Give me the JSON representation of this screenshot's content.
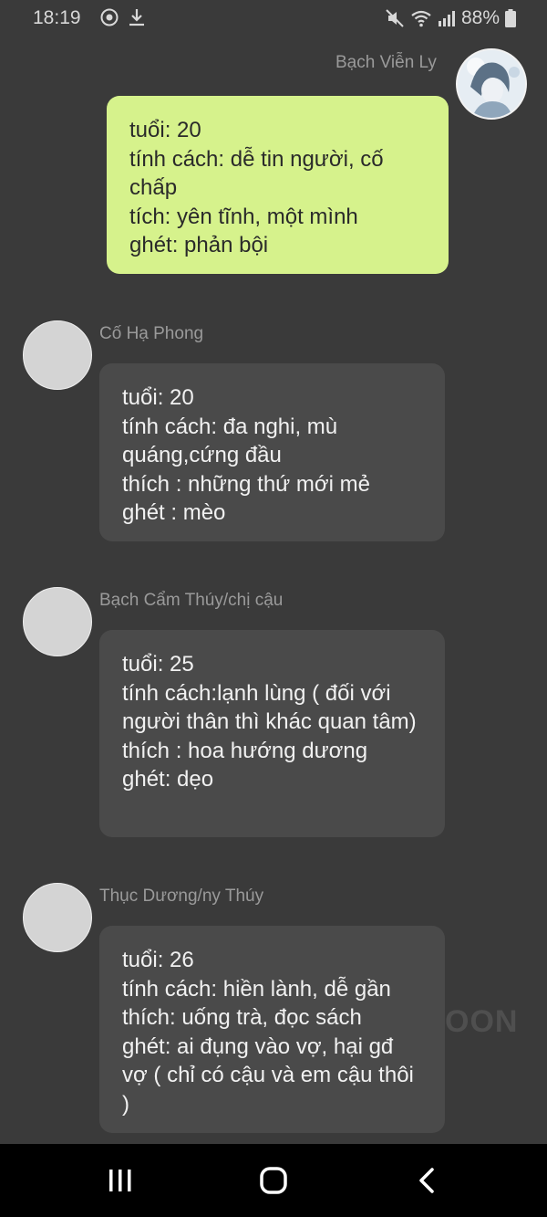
{
  "status_bar": {
    "time": "18:19",
    "battery": "88%",
    "icons_left": [
      "messenger-icon",
      "download-icon"
    ],
    "icons_right": [
      "mute-icon",
      "wifi-icon",
      "signal-icon",
      "battery-icon"
    ]
  },
  "messages": [
    {
      "sender": "Bạch Viễn Ly",
      "side": "right",
      "lines": [
        "tuổi: 20",
        "tính cách: dễ tin người, cố chấp",
        "tích: yên tĩnh, một mình",
        "ghét: phản bội"
      ]
    },
    {
      "sender": "Cố Hạ Phong",
      "side": "left",
      "lines": [
        "tuổi: 20",
        "tính cách: đa nghi, mù quáng,cứng đầu",
        "thích : những thứ mới mẻ",
        "ghét : mèo"
      ]
    },
    {
      "sender": "Bạch Cẩm Thúy/chị cậu",
      "side": "left",
      "lines": [
        "tuổi: 25",
        "tính cách:lạnh lùng ( đối với người thân thì khác quan tâm)",
        "thích : hoa hướng dương",
        "ghét: dẹo"
      ]
    },
    {
      "sender": "Thục Dương/ny Thúy",
      "side": "left",
      "lines": [
        "tuổi: 26",
        "tính cách: hiền lành, dễ gần",
        "thích: uống trà, đọc sách",
        "ghét: ai đụng vào vợ, hại gđ vợ ( chỉ có cậu và em cậu thôi )"
      ]
    }
  ],
  "watermark": "OON",
  "nav_bar": {
    "buttons": [
      "recents-icon",
      "home-icon",
      "back-icon"
    ]
  },
  "colors": {
    "background": "#3a3a3a",
    "user_bubble": "#d6f28c",
    "other_bubble": "#4a4a4a"
  }
}
